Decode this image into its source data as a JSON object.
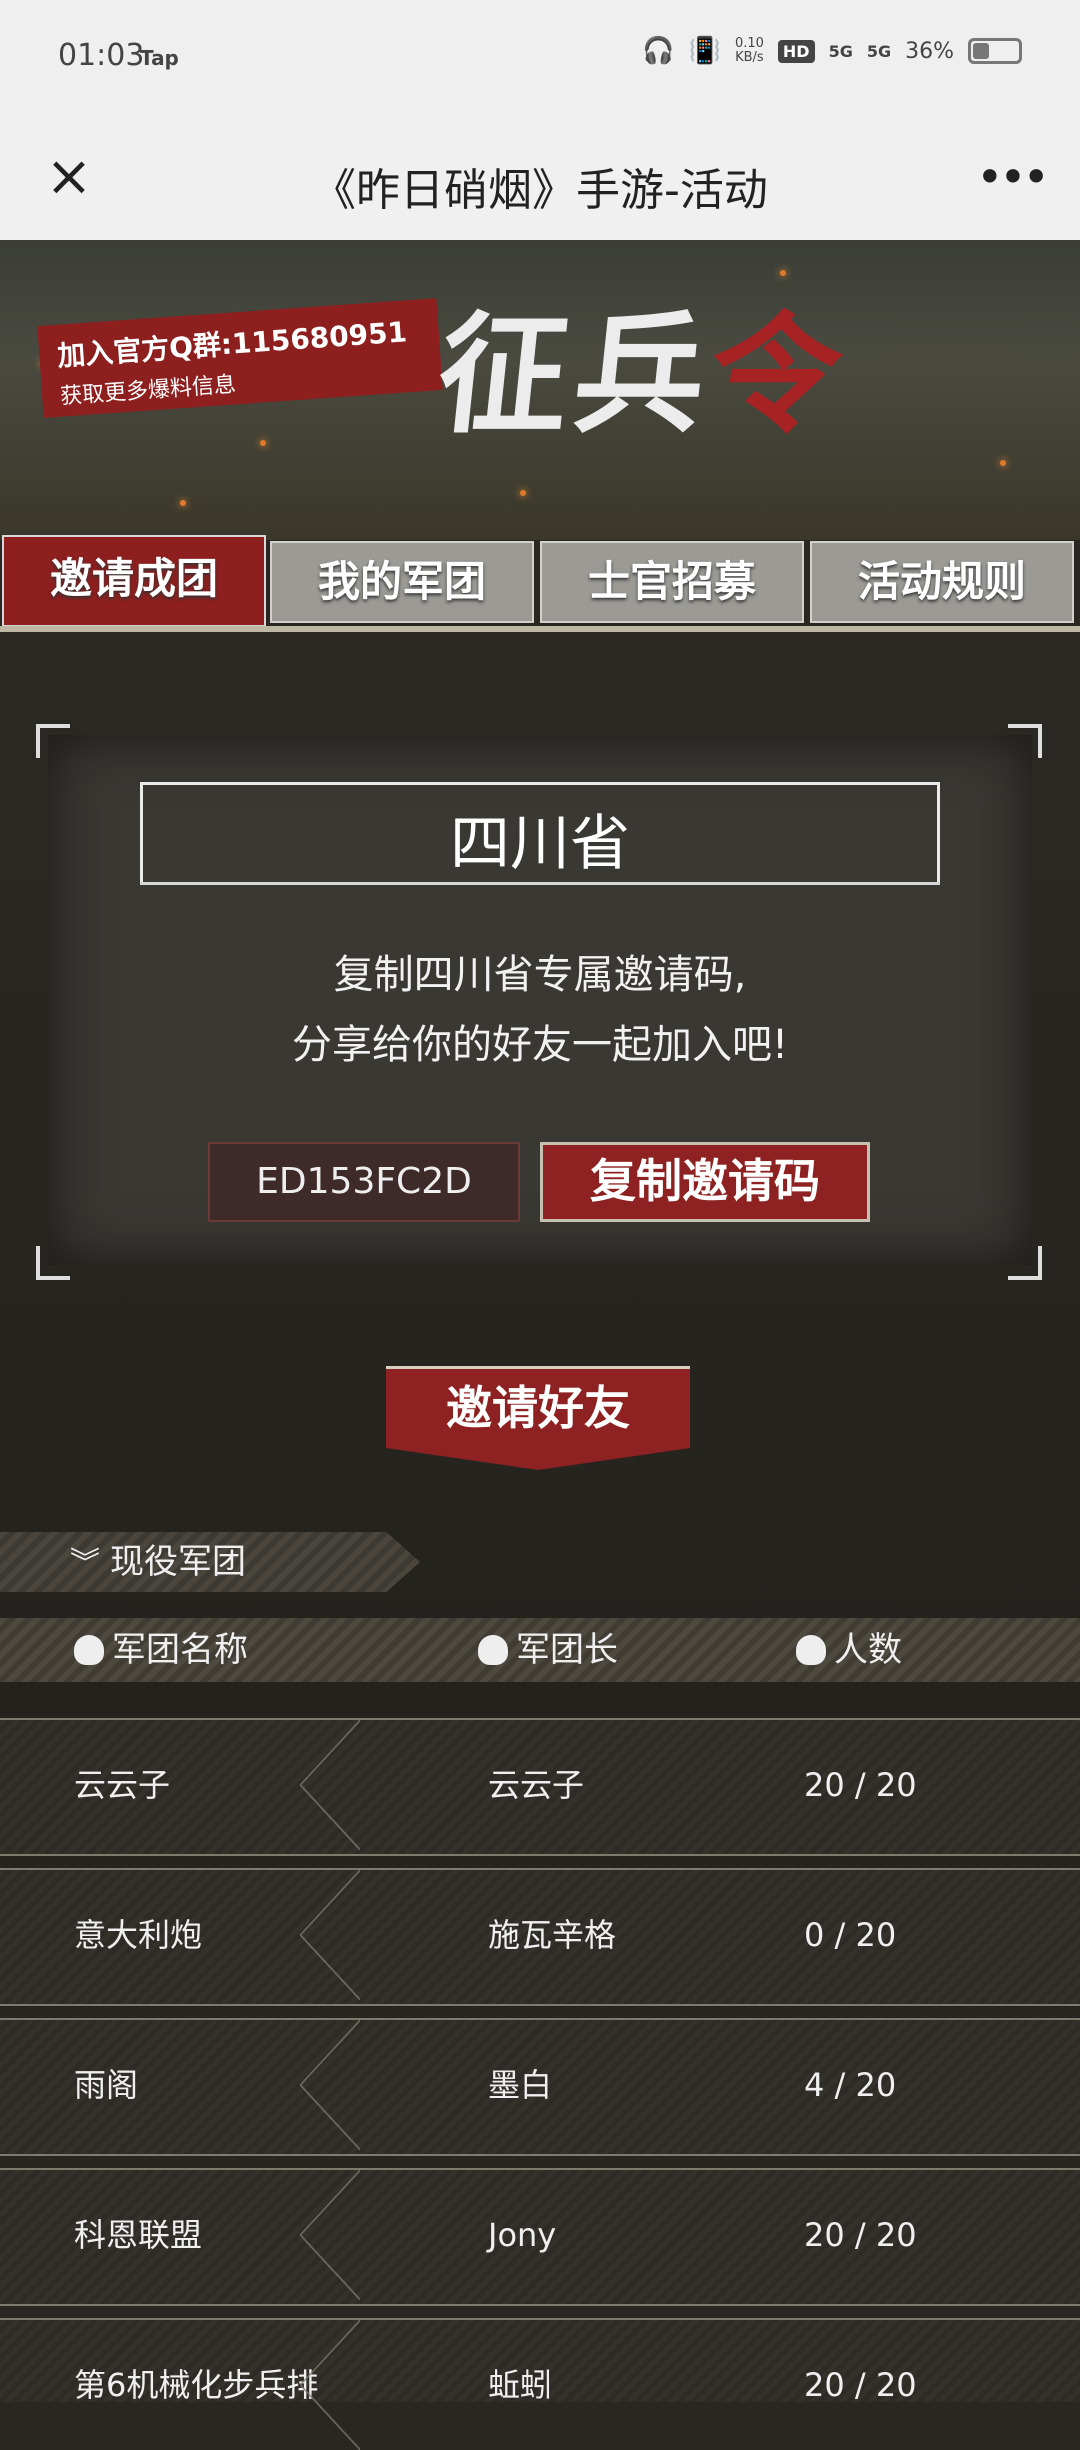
{
  "status_bar": {
    "time": "01:03",
    "tap": "Tap",
    "speed_top": "0.10",
    "speed_unit": "KB/s",
    "hd": "HD",
    "sig1": "5G",
    "sig2": "5G",
    "battery": "36%",
    "battery_level": 0.36
  },
  "title_bar": {
    "close_icon": "×",
    "title": "《昨日硝烟》手游-活动",
    "more_icon": "•••"
  },
  "banner": {
    "qq_line1": "加入官方Q群:115680951",
    "qq_line2": "获取更多爆料信息",
    "recruit_main": "征兵",
    "recruit_red": "令"
  },
  "tabs": [
    {
      "label": "邀请成团",
      "active": true
    },
    {
      "label": "我的军团",
      "active": false
    },
    {
      "label": "士官招募",
      "active": false
    },
    {
      "label": "活动规则",
      "active": false
    }
  ],
  "invite_card": {
    "province": "四川省",
    "desc_line1": "复制四川省专属邀请码,",
    "desc_line2": "分享给你的好友一起加入吧!",
    "code": "ED153FC2D",
    "copy_button": "复制邀请码"
  },
  "invite_friend_button": "邀请好友",
  "legion_list": {
    "section_title": "现役军团",
    "headers": {
      "name": "军团名称",
      "leader": "军团长",
      "count": "人数"
    },
    "rows": [
      {
        "name": "云云子",
        "leader": "云云子",
        "count": "20 / 20"
      },
      {
        "name": "意大利炮",
        "leader": "施瓦辛格",
        "count": "0 / 20"
      },
      {
        "name": "雨阁",
        "leader": "墨白",
        "count": "4 / 20"
      },
      {
        "name": "科恩联盟",
        "leader": "Jony",
        "count": "20 / 20"
      },
      {
        "name": "第6机械化步兵排",
        "leader": "蚯蚓",
        "count": "20 / 20"
      }
    ]
  }
}
